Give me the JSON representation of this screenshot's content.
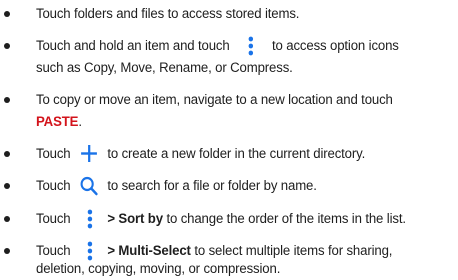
{
  "bullets": {
    "b1": {
      "text": "Touch folders and files to access stored items."
    },
    "b2": {
      "line1_a": "Touch and hold an item and touch",
      "line1_b": "to access option icons",
      "line2": "such as Copy, Move, Rename, or Compress."
    },
    "b3": {
      "line1": "To copy or move an item, navigate to a new location and touch",
      "paste": "PASTE",
      "period": "."
    },
    "b4": {
      "a": "Touch",
      "b": "to create a new folder in the current directory."
    },
    "b5": {
      "a": "Touch",
      "b": "to search for a file or folder by name."
    },
    "b6": {
      "a": "Touch",
      "bold": "> Sort by",
      "b": "to change the order of the items in the list."
    },
    "b7": {
      "a": "Touch",
      "bold": "> Multi-Select",
      "b": "to select multiple items for sharing,",
      "line2": "deletion, copying, moving, or compression."
    }
  },
  "icons": {
    "more": "more-vert-icon",
    "add": "plus-icon",
    "search": "search-icon"
  },
  "colors": {
    "text": "#1e1e1e",
    "accent": "#1a73e8",
    "highlight": "#d3131b"
  }
}
